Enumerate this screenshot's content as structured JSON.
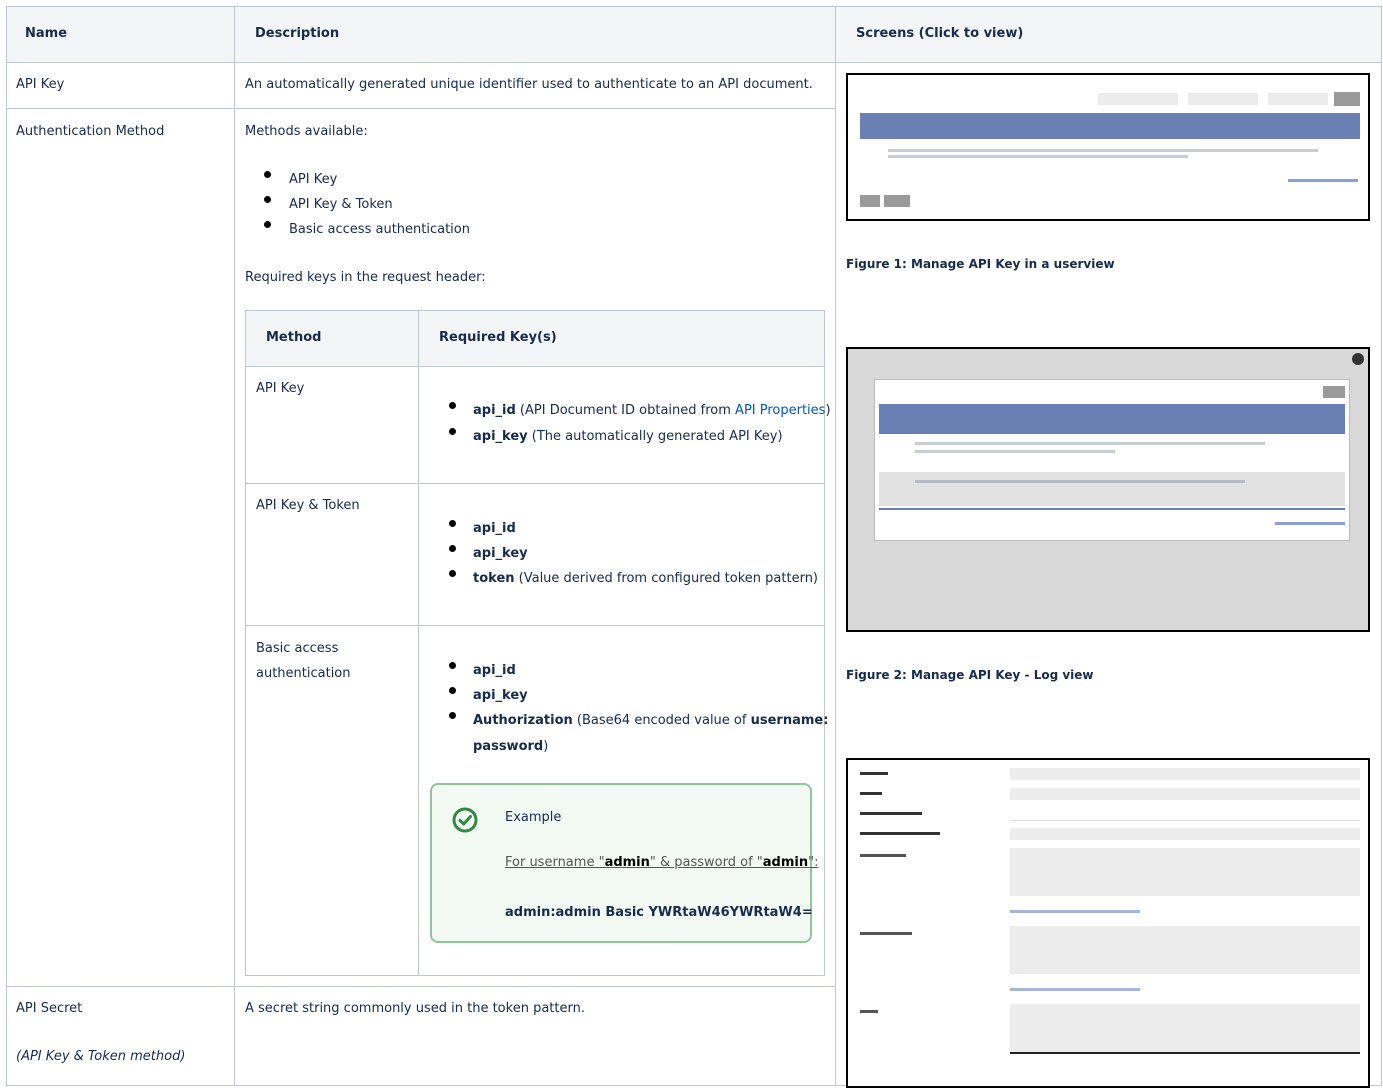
{
  "headers": {
    "name": "Name",
    "description": "Description",
    "screens": "Screens (Click to view)"
  },
  "rows": {
    "api_key": {
      "name": "API Key",
      "description": "An automatically generated unique identifier used to authenticate to an API document."
    },
    "auth": {
      "name": "Authentication Method",
      "methods_intro": "Methods available:",
      "methods": [
        "API Key",
        "API Key & Token",
        "Basic access authentication"
      ],
      "required_intro": "Required keys in the request header:",
      "inner_headers": {
        "method": "Method",
        "keys": "Required Key(s)"
      },
      "inner": {
        "api_key": {
          "method": "API Key",
          "k1": "api_id",
          "k1_desc_a": " (API Document ID obtained from ",
          "k1_link": "API Properties",
          "k1_desc_b": ")",
          "k2": "api_key",
          "k2_desc": " (The automatically generated API Key)"
        },
        "token": {
          "method": "API Key & Token",
          "k1": "api_id",
          "k2": "api_key",
          "k3": "token",
          "k3_desc": " (Value derived from configured token pattern)"
        },
        "basic": {
          "method_line1": "Basic access",
          "method_line2": "authentication",
          "k1": "api_id",
          "k2": "api_key",
          "k3": "Authorization",
          "k3_desc": " (Base64 encoded value of ",
          "k3_bold": "username:",
          "k3_bold2": "password",
          "k3_end": ")",
          "example": {
            "title": "Example",
            "line_a": "For username \"",
            "user": "admin",
            "line_b": "\" & password of \"",
            "pass": "admin",
            "line_c": "\":",
            "code": "admin:admin  Basic YWRtaW46YWRtaW4="
          }
        }
      }
    },
    "secret": {
      "name": "API Secret",
      "name_note": "(API Key & Token method)",
      "description": "A secret string commonly used in the token pattern."
    }
  },
  "figures": {
    "fig1": "Figure 1: Manage API Key in a userview",
    "fig2": "Figure 2: Manage API Key - Log view"
  }
}
